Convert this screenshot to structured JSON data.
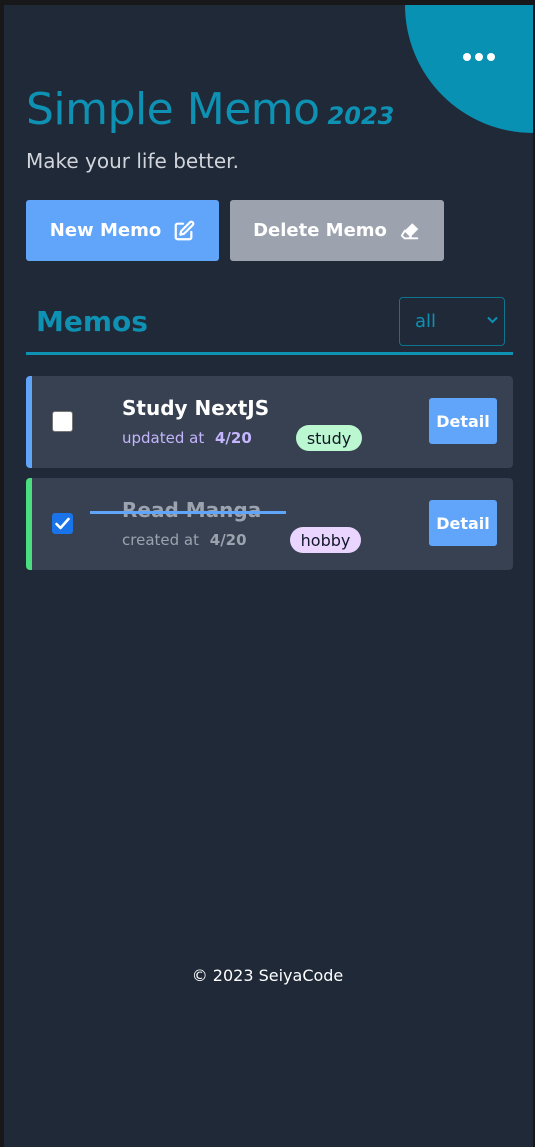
{
  "app": {
    "title": "Simple Memo",
    "year": "2023",
    "tagline": "Make your life better."
  },
  "toolbar": {
    "new_label": "New Memo",
    "delete_label": "Delete Memo",
    "new_icon": "edit-icon",
    "delete_icon": "eraser-icon"
  },
  "memos": {
    "heading": "Memos",
    "filter_value": "all",
    "items": [
      {
        "title": "Study NextJS",
        "meta_label": "updated at",
        "date": "4/20",
        "tag": "study",
        "checked": false,
        "detail_label": "Detail"
      },
      {
        "title": "Read Manga",
        "meta_label": "created at",
        "date": "4/20",
        "tag": "hobby",
        "checked": true,
        "detail_label": "Detail"
      }
    ]
  },
  "footer": "© 2023 SeiyaCode",
  "colors": {
    "background": "#1f2937",
    "accent": "#0e91b3",
    "primary_button": "#60a5fa",
    "secondary_button": "#9ca3af",
    "card": "#374151",
    "study_stripe": "#60a5fa",
    "hobby_stripe": "#4ade80",
    "study_tag": "#bbf7d0",
    "hobby_tag": "#e9d5ff",
    "updated_meta": "#c4b5fd",
    "created_meta": "#9ca3af"
  }
}
